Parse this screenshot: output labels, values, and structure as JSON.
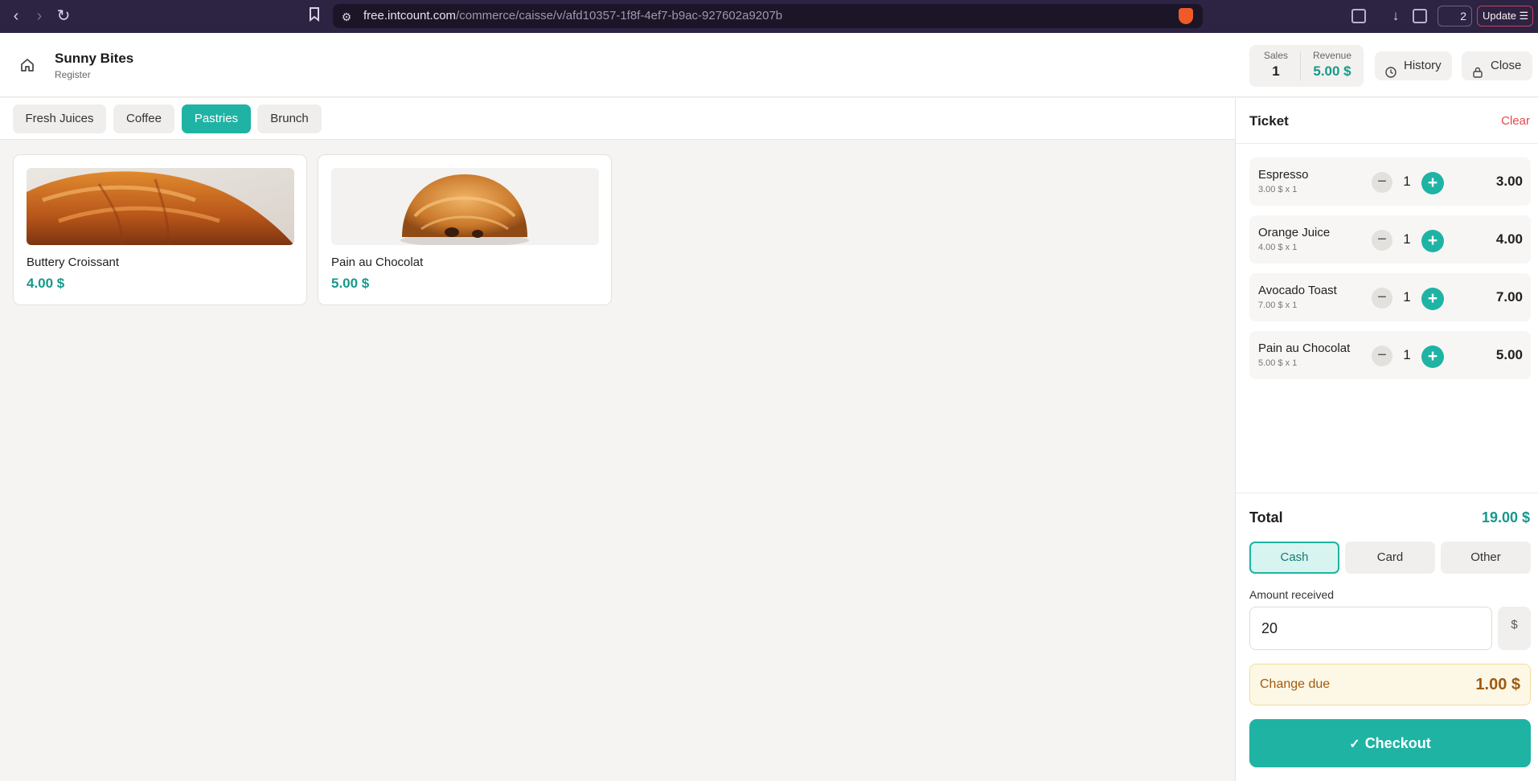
{
  "browser": {
    "url_host": "free.intcount.com",
    "url_path": "/commerce/caisse/v/afd10357-1f8f-4ef7-b9ac-927602a9207b",
    "extension_count": "2",
    "update_label": "Update"
  },
  "header": {
    "shop_name": "Sunny Bites",
    "shop_subtitle": "Register",
    "sales_label": "Sales",
    "sales_value": "1",
    "revenue_label": "Revenue",
    "revenue_value": "5.00 $",
    "history_label": "History",
    "close_label": "Close"
  },
  "categories": [
    {
      "label": "Fresh Juices",
      "active": false
    },
    {
      "label": "Coffee",
      "active": false
    },
    {
      "label": "Pastries",
      "active": true
    },
    {
      "label": "Brunch",
      "active": false
    }
  ],
  "products": [
    {
      "name": "Buttery Croissant",
      "price": "4.00 $",
      "image": "croissant-image"
    },
    {
      "name": "Pain au Chocolat",
      "price": "5.00 $",
      "image": "pain-au-chocolat-image"
    }
  ],
  "ticket": {
    "title": "Ticket",
    "clear_label": "Clear",
    "lines": [
      {
        "name": "Espresso",
        "detail": "3.00 $ x 1",
        "qty": "1",
        "total": "3.00"
      },
      {
        "name": "Orange Juice",
        "detail": "4.00 $ x 1",
        "qty": "1",
        "total": "4.00"
      },
      {
        "name": "Avocado Toast",
        "detail": "7.00 $ x 1",
        "qty": "1",
        "total": "7.00"
      },
      {
        "name": "Pain au Chocolat",
        "detail": "5.00 $ x 1",
        "qty": "1",
        "total": "5.00"
      }
    ],
    "total_label": "Total",
    "total_value": "19.00 $",
    "payment_methods": [
      {
        "label": "Cash",
        "active": true
      },
      {
        "label": "Card",
        "active": false
      },
      {
        "label": "Other",
        "active": false
      }
    ],
    "amount_label": "Amount received",
    "amount_value": "20",
    "currency": "$",
    "change_label": "Change due",
    "change_value": "1.00 $",
    "checkout_label": "Checkout"
  },
  "colors": {
    "accent": "#1fb3a4",
    "accent_text": "#16998b",
    "danger": "#e5484d",
    "browser_bg": "#2d2342"
  }
}
